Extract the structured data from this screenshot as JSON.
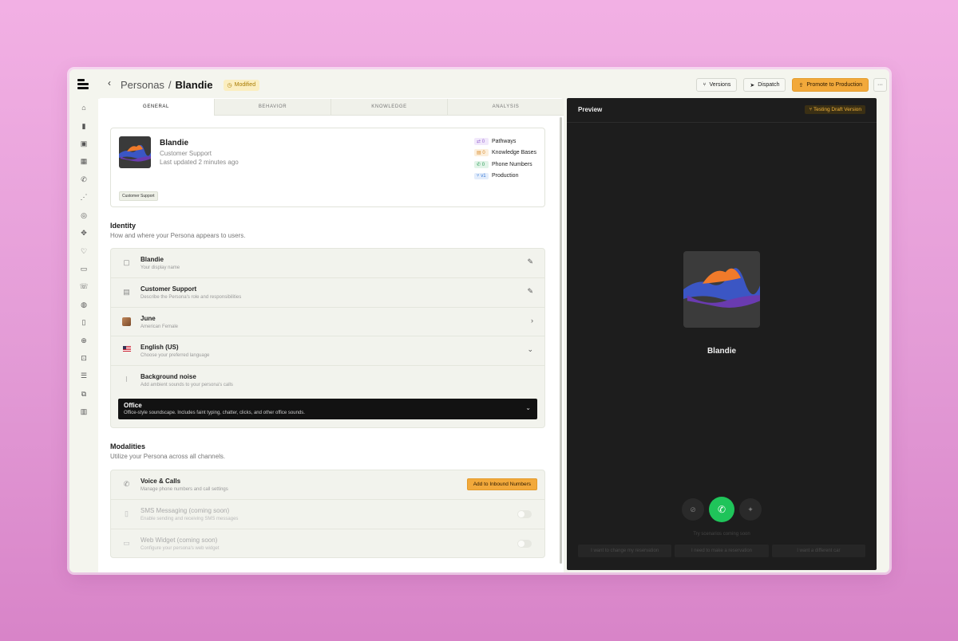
{
  "header": {
    "back_icon": "chevron-left-icon",
    "breadcrumb_parent": "Personas",
    "breadcrumb_sep": "/",
    "breadcrumb_current": "Blandie",
    "status_badge": "Modified",
    "buttons": {
      "versions": "Versions",
      "dispatch": "Dispatch",
      "promote": "Promote to Production",
      "more": "···"
    }
  },
  "tabs": [
    "GENERAL",
    "BEHAVIOR",
    "KNOWLEDGE",
    "ANALYSIS"
  ],
  "persona_card": {
    "name": "Blandie",
    "role": "Customer Support",
    "updated": "Last updated 2 minutes ago",
    "tag": "Customer Support",
    "stats": [
      {
        "chip": "0",
        "label": "Pathways",
        "color": "#c9a8f0",
        "bg": "#f1e8fb"
      },
      {
        "chip": "0",
        "label": "Knowledge Bases",
        "color": "#d88b2e",
        "bg": "#fcefdc"
      },
      {
        "chip": "0",
        "label": "Phone Numbers",
        "color": "#2f9e5a",
        "bg": "#e2f4e8"
      },
      {
        "chip": "v1",
        "label": "Production",
        "color": "#3a7bd5",
        "bg": "#e3edfb"
      }
    ]
  },
  "identity": {
    "title": "Identity",
    "subtitle": "How and where your Persona appears to users.",
    "rows": [
      {
        "title": "Blandie",
        "sub": "Your display name",
        "icon": "user-card-icon",
        "action": "pencil-icon"
      },
      {
        "title": "Customer Support",
        "sub": "Describe the Persona's role and responsibilities",
        "icon": "briefcase-icon",
        "action": "pencil-icon"
      },
      {
        "title": "June",
        "sub": "American Female",
        "icon": "voice-avatar-icon",
        "action": "chevron-right-icon"
      },
      {
        "title": "English (US)",
        "sub": "Choose your preferred language",
        "icon": "us-flag-icon",
        "action": "chevron-down-icon"
      },
      {
        "title": "Background noise",
        "sub": "Add ambient sounds to your persona's calls",
        "icon": "waveform-icon"
      }
    ],
    "noise_select": {
      "title": "Office",
      "sub": "Office-style soundscape. Includes faint typing, chatter, clicks, and other office sounds."
    }
  },
  "modalities": {
    "title": "Modalities",
    "subtitle": "Utilize your Persona across all channels.",
    "rows": [
      {
        "title": "Voice & Calls",
        "sub": "Manage phone numbers and call settings",
        "button": "Add to Inbound Numbers"
      },
      {
        "title": "SMS Messaging (coming soon)",
        "sub": "Enable sending and receiving SMS messages"
      },
      {
        "title": "Web Widget (coming soon)",
        "sub": "Configure your persona's web widget"
      }
    ]
  },
  "preview": {
    "title": "Preview",
    "badge": "Testing Draft Version",
    "name": "Blandie",
    "hint": "Try scenarios coming soon",
    "suggestions": [
      "I want to change my reservation",
      "I need to make a reservation",
      "I want a different car"
    ]
  }
}
